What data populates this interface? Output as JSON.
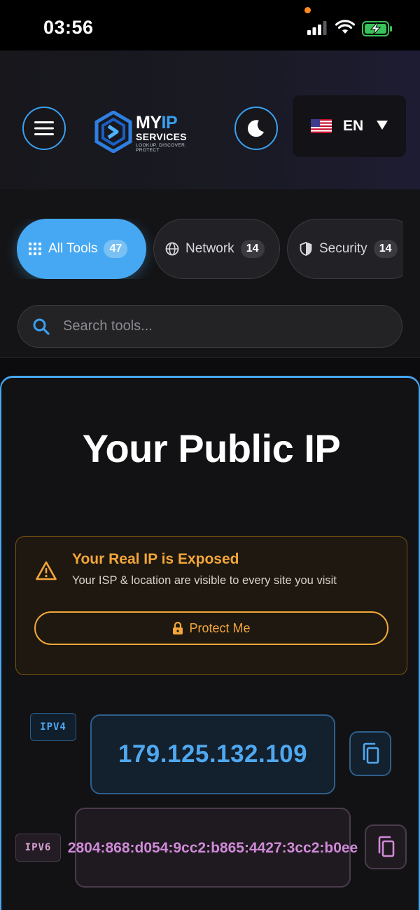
{
  "status_bar": {
    "time": "03:56"
  },
  "header": {
    "logo": {
      "brand_my": "MY",
      "brand_ip": "IP",
      "brand_services": "SERVICES",
      "tagline": "LOOKUP. DISCOVER. PROTECT"
    },
    "language": {
      "code": "EN",
      "flag": "us-flag"
    }
  },
  "filters": {
    "chips": [
      {
        "label": "All Tools",
        "count": "47",
        "icon": "grid-icon",
        "active": true
      },
      {
        "label": "Network",
        "count": "14",
        "icon": "globe-icon",
        "active": false
      },
      {
        "label": "Security",
        "count": "14",
        "icon": "shield-icon",
        "active": false
      }
    ]
  },
  "search": {
    "placeholder": "Search tools...",
    "value": ""
  },
  "main": {
    "title": "Your Public IP",
    "alert": {
      "title": "Your Real IP is Exposed",
      "subtitle": "Your ISP & location are visible to every site you visit",
      "button_label": "Protect Me"
    },
    "ipv4": {
      "label": "IPV4",
      "address": "179.125.132.109"
    },
    "ipv6": {
      "label": "IPV6",
      "address": "2804:868:d054:9cc2:b865:4427:3cc2:b0ee"
    }
  },
  "colors": {
    "accent": "#46a8f2",
    "warning": "#f3a63a",
    "ipv6": "#d08ad8"
  }
}
